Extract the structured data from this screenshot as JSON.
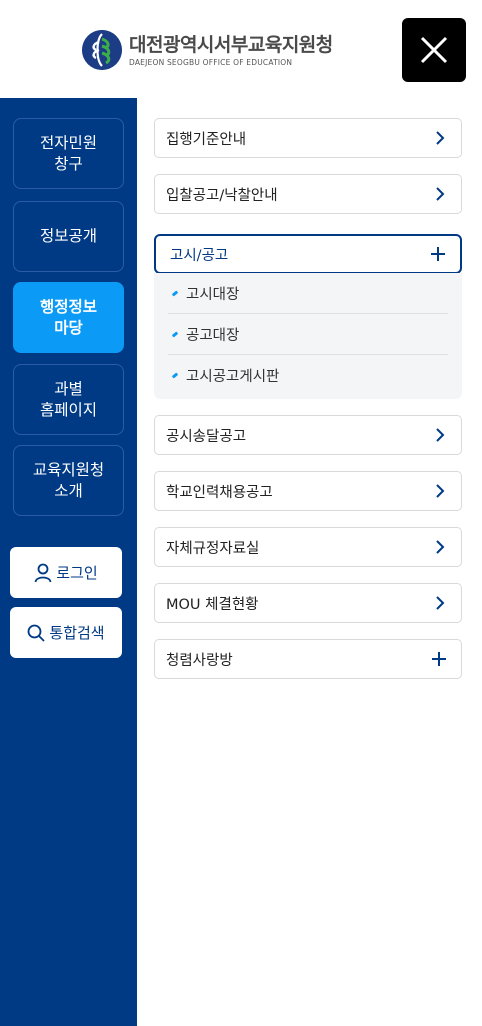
{
  "header": {
    "logo_title": "대전광역시서부교육지원청",
    "logo_subtitle": "DAEJEON SEOGBU OFFICE OF EDUCATION",
    "close_icon": "close-icon"
  },
  "sidebar": {
    "items": [
      {
        "label": "전자민원\n창구",
        "active": false
      },
      {
        "label": "정보공개",
        "active": false
      },
      {
        "label": "행정정보\n마당",
        "active": true
      },
      {
        "label": "과별\n홈페이지",
        "active": false
      },
      {
        "label": "교육지원청\n소개",
        "active": false
      }
    ],
    "login_label": "로그인",
    "search_label": "통합검색",
    "colors": {
      "background": "#003a85",
      "active": "#0b9af5"
    }
  },
  "menu": {
    "items": [
      {
        "label": "집행기준안내",
        "icon": "chevron-right-icon"
      },
      {
        "label": "입찰공고/낙찰안내",
        "icon": "chevron-right-icon"
      },
      {
        "label": "고시/공고",
        "icon": "plus-icon",
        "expanded": true
      },
      {
        "label": "공시송달공고",
        "icon": "chevron-right-icon"
      },
      {
        "label": "학교인력채용공고",
        "icon": "chevron-right-icon"
      },
      {
        "label": "자체규정자료실",
        "icon": "chevron-right-icon"
      },
      {
        "label": "MOU 체결현황",
        "icon": "chevron-right-icon"
      },
      {
        "label": "청렴사랑방",
        "icon": "plus-icon"
      }
    ],
    "sub_items": [
      "고시대장",
      "공고대장",
      "고시공고게시판"
    ]
  }
}
